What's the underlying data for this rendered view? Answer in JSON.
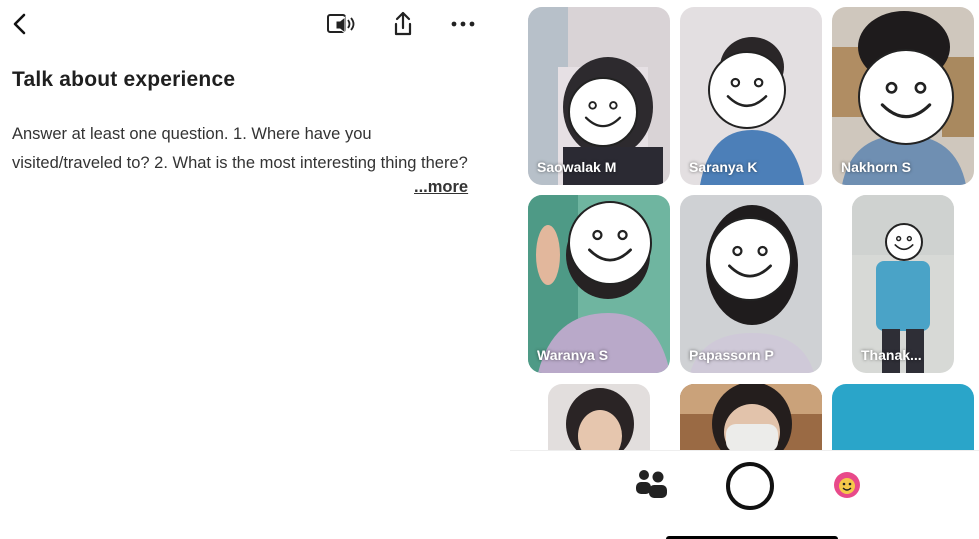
{
  "prompt": {
    "title": "Talk about experience",
    "description": "Answer at least one question. 1. Where have you visited/traveled to? 2. What is the most interesting thing there?",
    "more_label": "...more"
  },
  "toolbar": {
    "icons": [
      "back-icon",
      "speaker-caption-icon",
      "share-icon",
      "more-options-icon"
    ]
  },
  "participants": [
    {
      "name": "Saowalak M"
    },
    {
      "name": "Saranya K"
    },
    {
      "name": "Nakhorn S"
    },
    {
      "name": "Waranya S"
    },
    {
      "name": "Papassorn P"
    },
    {
      "name": "Thanak..."
    }
  ],
  "bottom_bar": {
    "icons": [
      "participants-icon",
      "capture-button",
      "emoji-icon"
    ]
  },
  "colors": {
    "text": "#1f1f1f",
    "teal_tile": "#2aa5c9",
    "emoji": "#e84a8a",
    "emoji_face": "#f6c94a"
  }
}
